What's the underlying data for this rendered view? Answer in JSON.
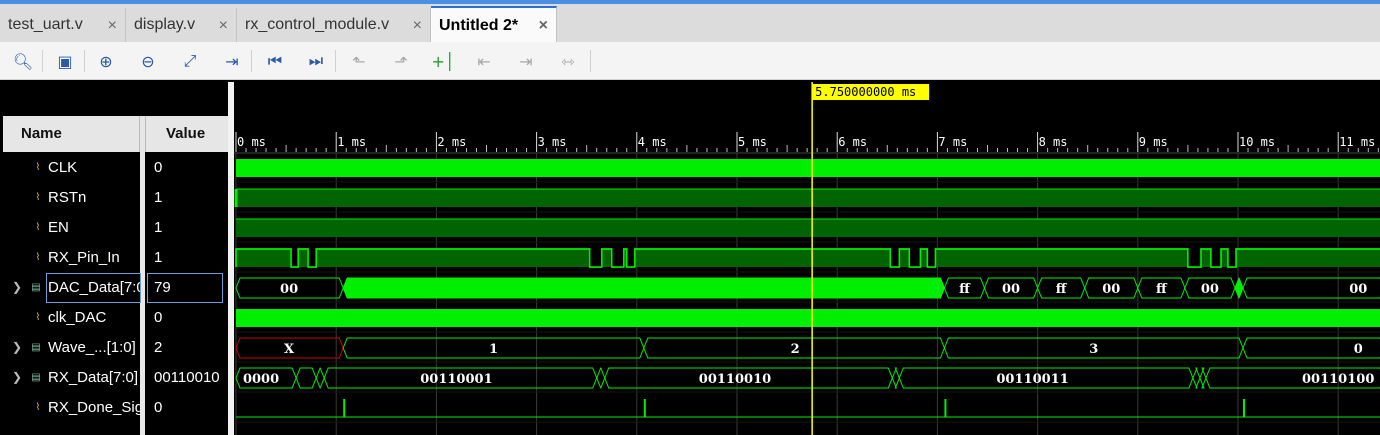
{
  "tabs": [
    {
      "label": "test_uart.v",
      "close": "×"
    },
    {
      "label": "display.v",
      "close": "×"
    },
    {
      "label": "rx_control_module.v",
      "close": "×"
    },
    {
      "label": "Untitled 2*",
      "close": "×"
    }
  ],
  "toolbar": {
    "buttons": [
      "search-icon",
      "save-icon",
      "zoom-in-icon",
      "zoom-out-icon",
      "zoom-fit-icon",
      "go-to-cursor-icon",
      "go-to-start-icon",
      "go-to-end-icon",
      "previous-transition-icon",
      "next-transition-icon",
      "add-marker-icon",
      "previous-marker-icon",
      "next-marker-icon",
      "swap-cursors-icon"
    ]
  },
  "header": {
    "name": "Name",
    "value": "Value"
  },
  "cursor": {
    "label": "5.750000000 ms",
    "time_ms": 5.75
  },
  "timeline": {
    "ticks": [
      "0 ms",
      "1 ms",
      "2 ms",
      "3 ms",
      "4 ms",
      "5 ms",
      "6 ms",
      "7 ms",
      "8 ms",
      "9 ms",
      "10 ms",
      "11 ms"
    ]
  },
  "signals": [
    {
      "name": "CLK",
      "value": "0",
      "expandable": false,
      "bus": false
    },
    {
      "name": "RSTn",
      "value": "1",
      "expandable": false,
      "bus": false
    },
    {
      "name": "EN",
      "value": "1",
      "expandable": false,
      "bus": false
    },
    {
      "name": "RX_Pin_In",
      "value": "1",
      "expandable": false,
      "bus": false
    },
    {
      "name": "DAC_Data[7:0]",
      "value": "79",
      "expandable": true,
      "bus": true
    },
    {
      "name": "clk_DAC",
      "value": "0",
      "expandable": false,
      "bus": false
    },
    {
      "name": "Wave_...[1:0]",
      "value": "2",
      "expandable": true,
      "bus": true
    },
    {
      "name": "RX_Data[7:0]",
      "value": "00110010",
      "expandable": true,
      "bus": true
    },
    {
      "name": "RX_Done_Sig",
      "value": "0",
      "expandable": false,
      "bus": false
    }
  ],
  "wave_labels": {
    "dac": [
      "00",
      "ff",
      "00",
      "ff",
      "00",
      "ff",
      "00",
      "00"
    ],
    "wave_sel": [
      "X",
      "1",
      "2",
      "3",
      "0"
    ],
    "rx_data": [
      "0000",
      "00110001",
      "00110010",
      "00110011",
      "00110100"
    ]
  },
  "colors": {
    "wave": "#00ee00",
    "wave_dark": "#006400",
    "cursor": "#ffff00",
    "invalid": "#cc0000"
  }
}
